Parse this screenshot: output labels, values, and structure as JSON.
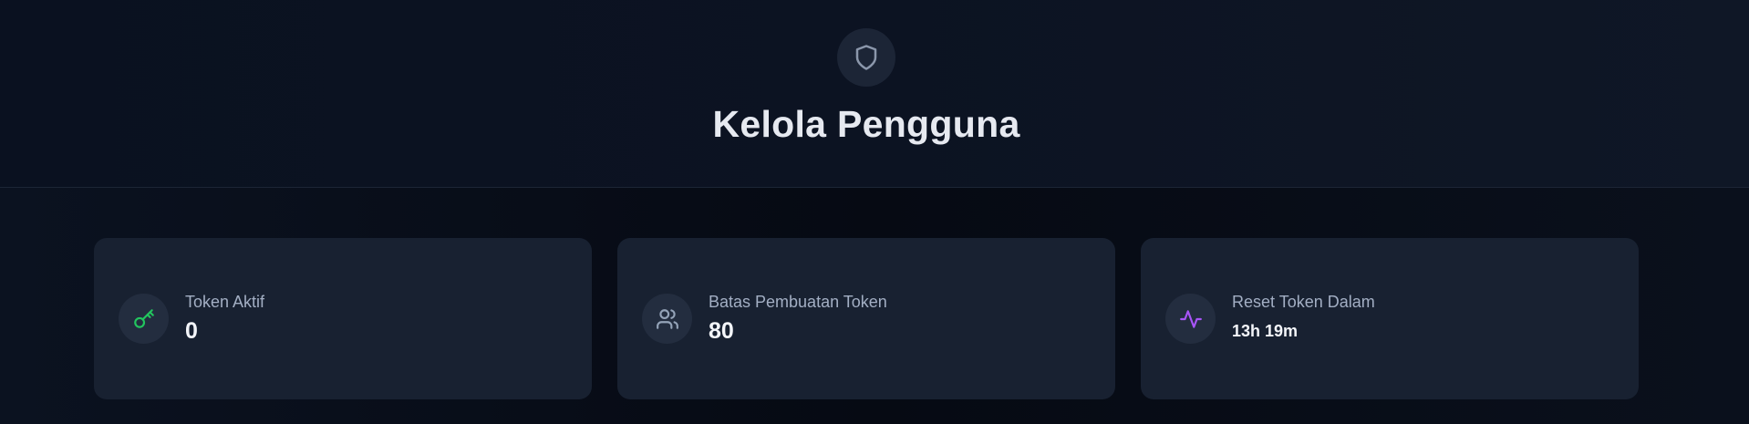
{
  "header": {
    "title": "Kelola Pengguna",
    "icon": "shield-icon"
  },
  "stats": [
    {
      "label": "Token Aktif",
      "value": "0",
      "icon": "key-icon",
      "icon_color": "#22c55e"
    },
    {
      "label": "Batas Pembuatan Token",
      "value": "80",
      "icon": "users-icon",
      "icon_color": "#94a3b8"
    },
    {
      "label": "Reset Token Dalam",
      "value": "13h 19m",
      "icon": "activity-icon",
      "icon_color": "#a855f7"
    }
  ],
  "colors": {
    "background": "#070c16",
    "card": "#182131",
    "text_primary": "#f3f5f9",
    "text_secondary": "#a3afc4"
  }
}
